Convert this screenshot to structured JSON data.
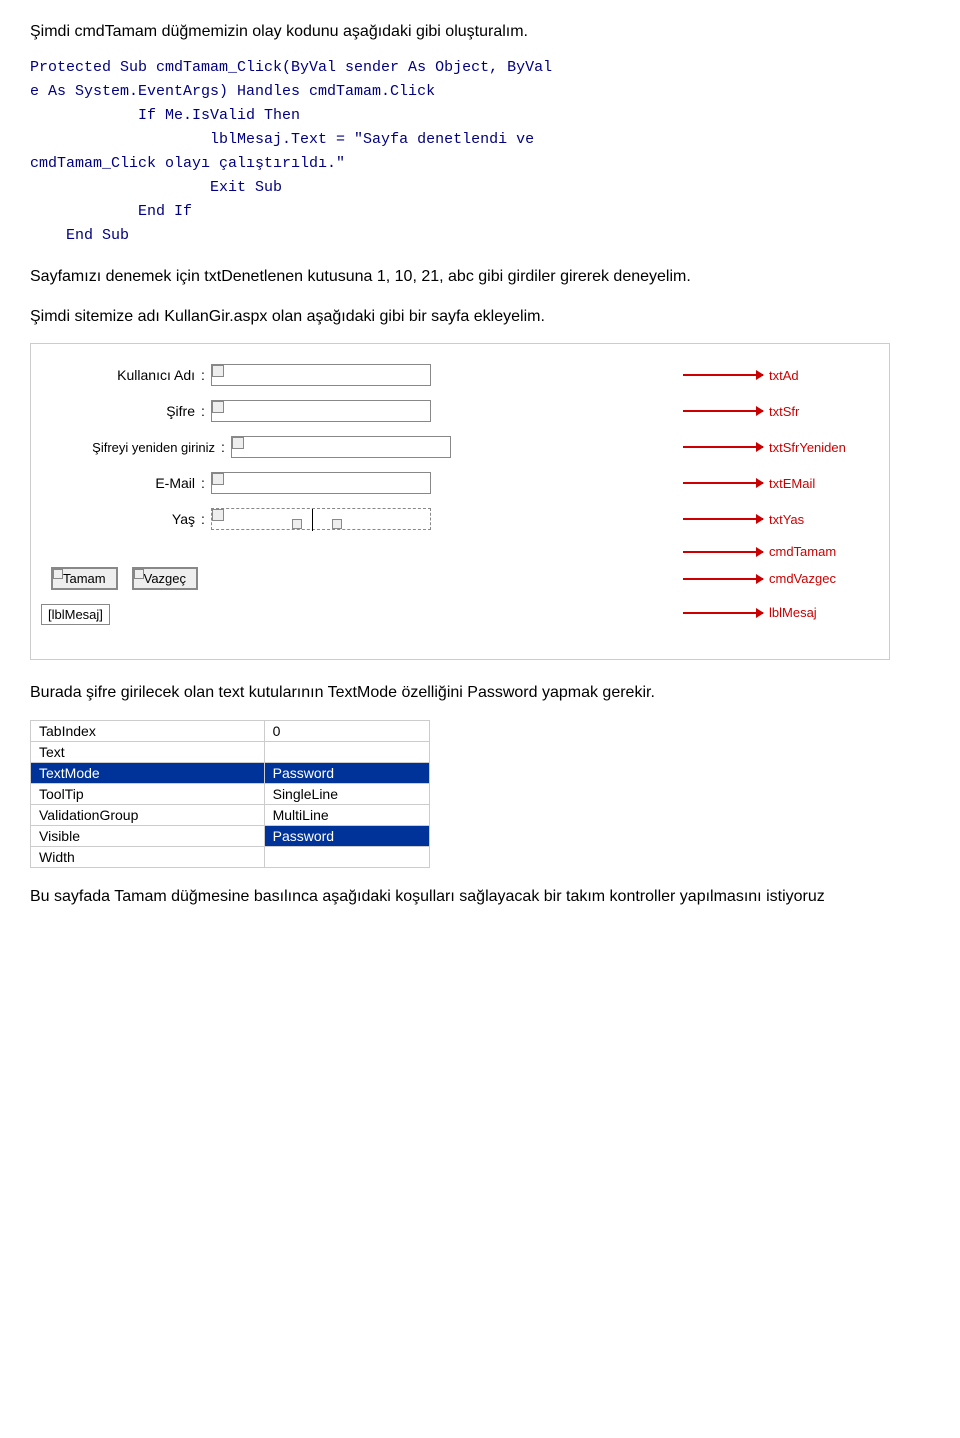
{
  "intro": {
    "text": "Şimdi cmdTamam düğmemizin olay kodunu aşağıdaki gibi oluşturalım."
  },
  "code": {
    "line1": "Protected Sub cmdTamam_Click(ByVal sender As Object, ByVal",
    "line2": "e As System.EventArgs) Handles cmdTamam.Click",
    "line3": "        If Me.IsValid Then",
    "line4": "            lblMesaj.Text = \"Sayfa denetlendi ve",
    "line5": "cmdTamam_Click olayı çalıştırıldı.\"",
    "line6": "            Exit Sub",
    "line7": "        End If",
    "line8": "    End Sub"
  },
  "para1": {
    "text": "Sayfamızı denemek için txtDenetlenen kutusuna 1, 10, 21, abc gibi girdiler girerek deneyelim."
  },
  "para2": {
    "text": "Şimdi sitemize adı KullanGir.aspx olan aşağıdaki gibi bir sayfa ekleyelim."
  },
  "form": {
    "rows": [
      {
        "label": "Kullanıcı Adı",
        "colon": ":",
        "control_name": "txtAd"
      },
      {
        "label": "Şifre",
        "colon": ":",
        "control_name": "txtSfr"
      },
      {
        "label": "Şifreyi yeniden giriniz",
        "colon": ":",
        "control_name": "txtSfrYeniden"
      },
      {
        "label": "E-Mail",
        "colon": ":",
        "control_name": "txtEMail"
      },
      {
        "label": "Yaş",
        "colon": ":",
        "control_name": "txtYas"
      }
    ],
    "btn_tamam": "Tamam",
    "btn_vazgec": "Vazgeç",
    "btn_tamam_name": "cmdTamam",
    "btn_vazgec_name": "cmdVazgec",
    "lbl_mesaj": "lblMesaj",
    "lbl_mesaj_display": "[lblMesaj]"
  },
  "para3": {
    "text": "Burada şifre girilecek olan text kutularının TextMode özelliğini Password yapmak gerekir."
  },
  "prop_table": {
    "rows": [
      {
        "prop": "TabIndex",
        "value": "0",
        "style": "normal"
      },
      {
        "prop": "Text",
        "value": "",
        "style": "normal"
      },
      {
        "prop": "TextMode",
        "value": "Password",
        "style": "selected"
      },
      {
        "prop": "ToolTip",
        "value": "SingleLine",
        "style": "normal"
      },
      {
        "prop": "ValidationGroup",
        "value": "MultiLine",
        "style": "normal"
      },
      {
        "prop": "Visible",
        "value": "Password",
        "style": "selected2"
      },
      {
        "prop": "Width",
        "value": "",
        "style": "normal"
      }
    ]
  },
  "para4": {
    "text": "Bu sayfada Tamam düğmesine basılınca aşağıdaki koşulları sağlayacak bir takım kontroller yapılmasını istiyoruz"
  }
}
